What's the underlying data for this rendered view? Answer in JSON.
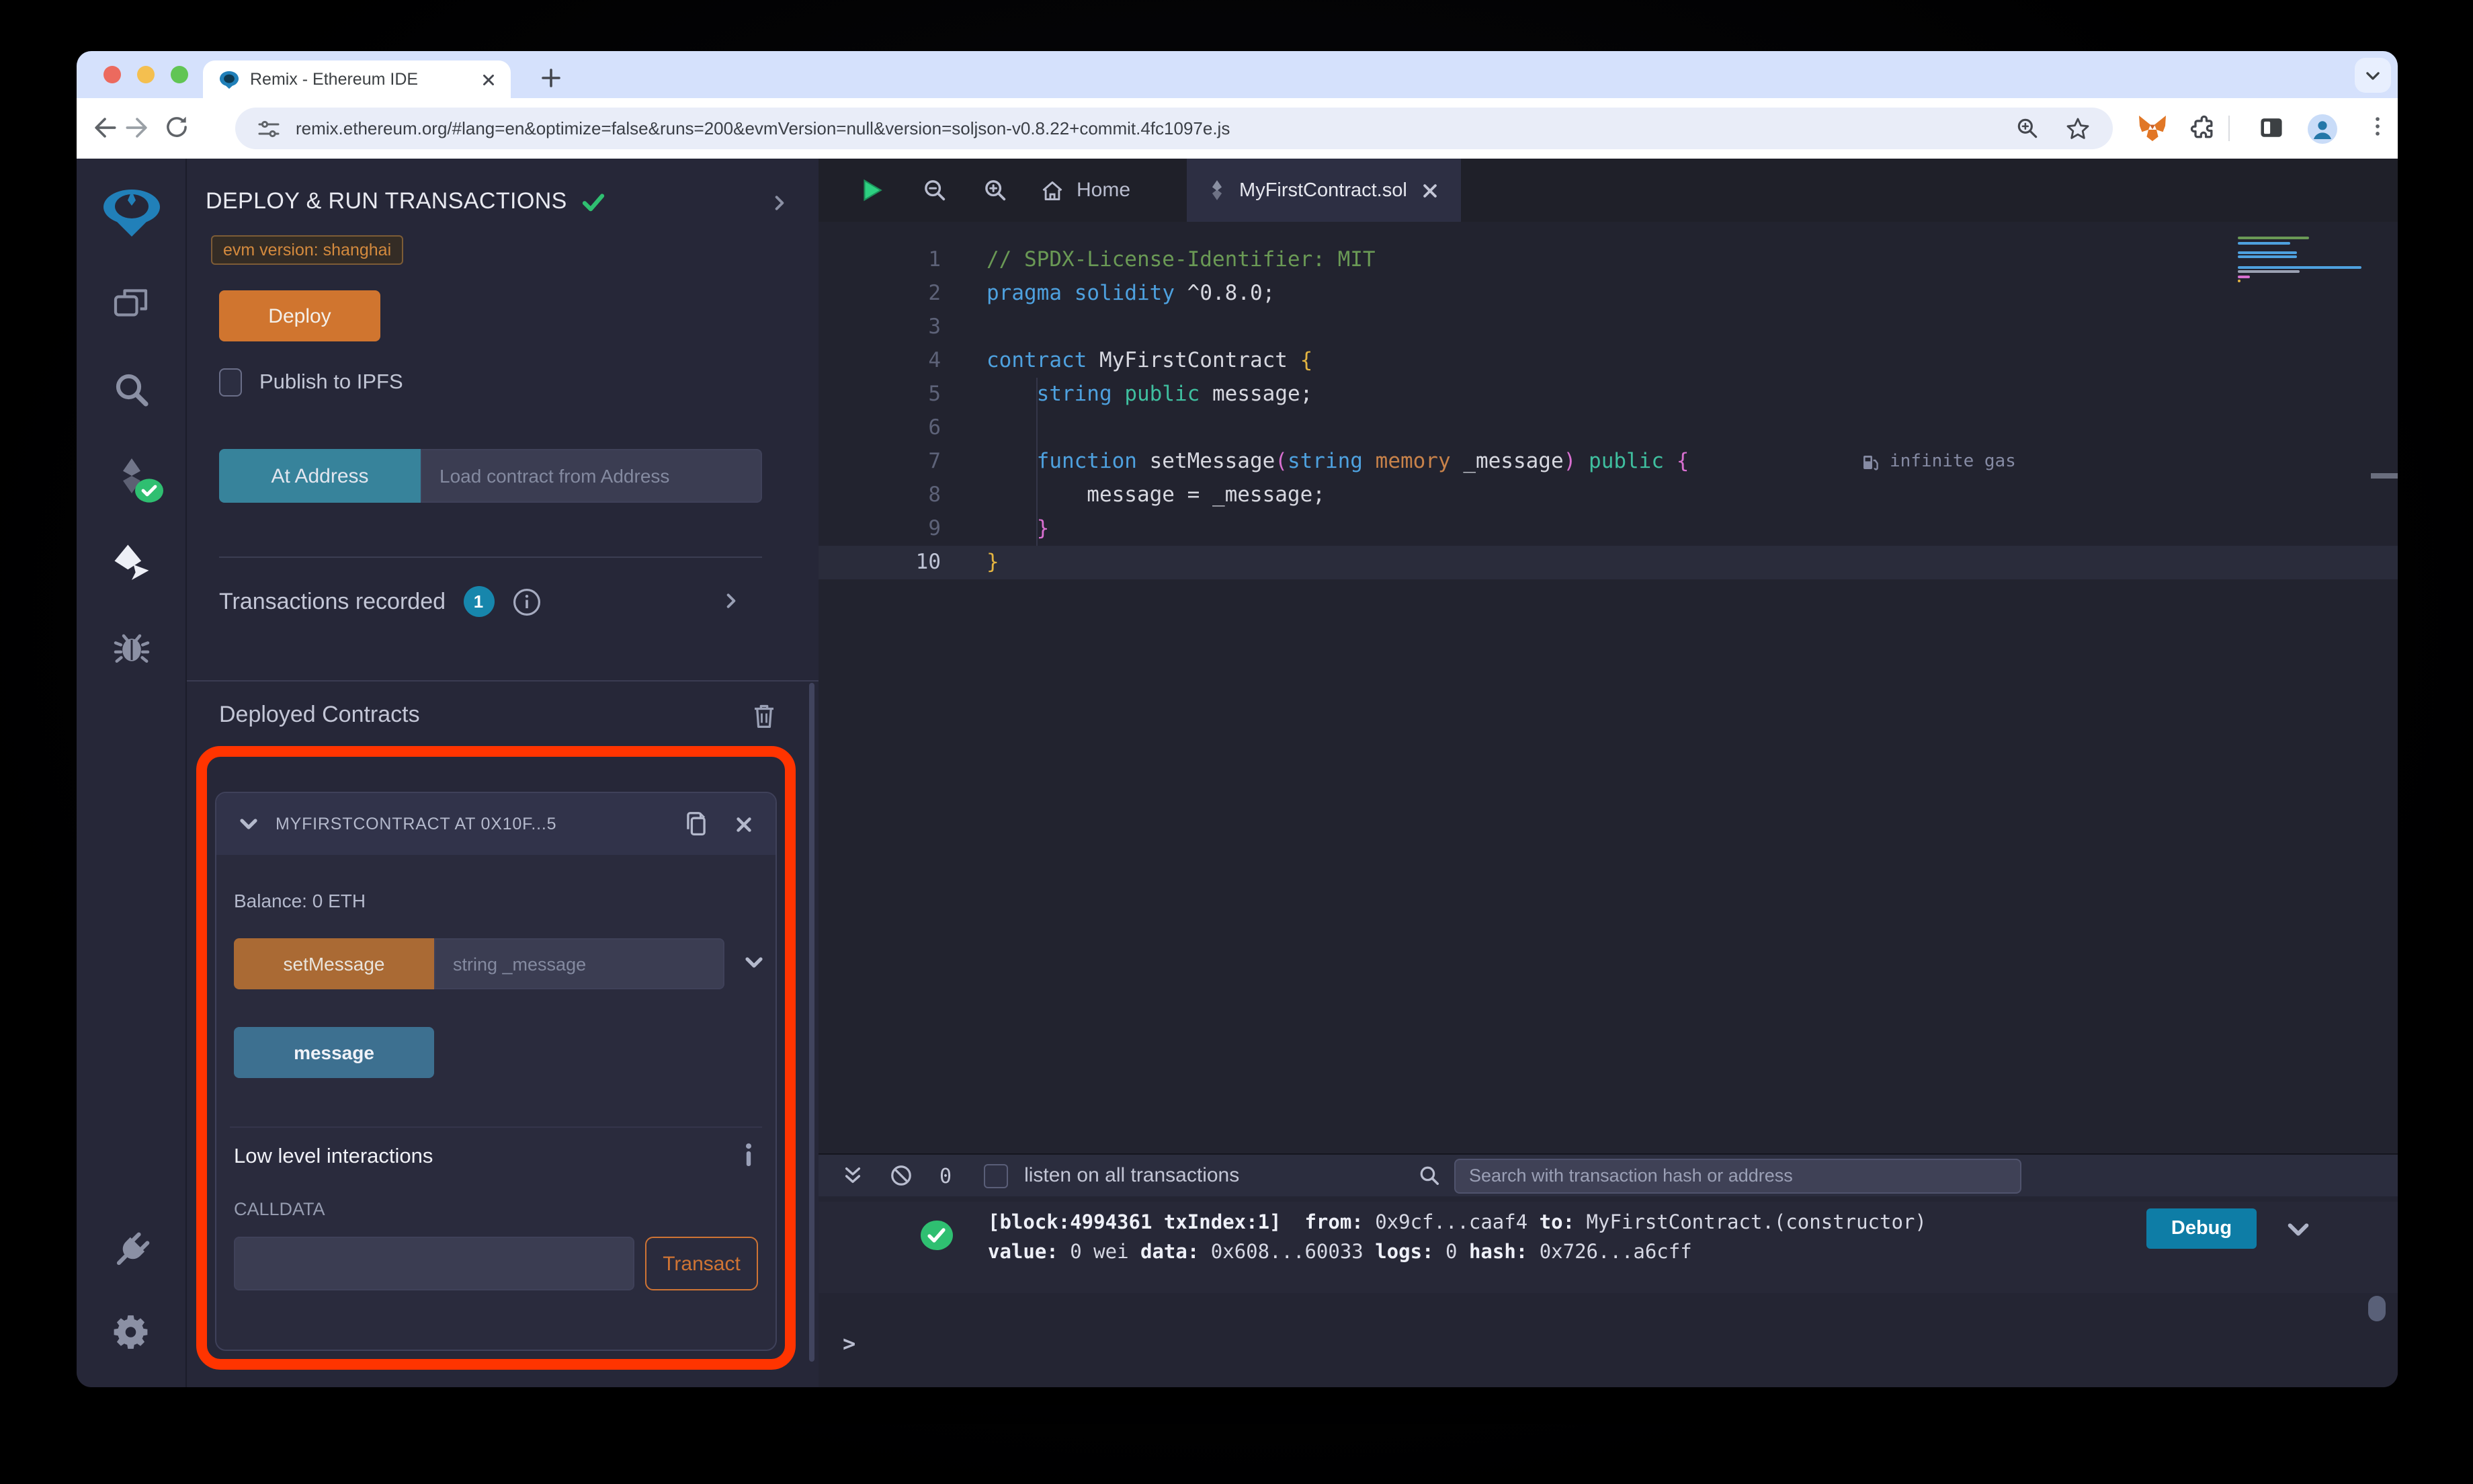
{
  "browser": {
    "tab_title": "Remix - Ethereum IDE",
    "url": "remix.ethereum.org/#lang=en&optimize=false&runs=200&evmVersion=null&version=soljson-v0.8.22+commit.4fc1097e.js"
  },
  "panel": {
    "title": "DEPLOY & RUN TRANSACTIONS",
    "evm_badge": "evm version: shanghai",
    "deploy_label": "Deploy",
    "publish_label": "Publish to IPFS",
    "at_address_label": "At Address",
    "at_address_placeholder": "Load contract from Address",
    "transactions_recorded_label": "Transactions recorded",
    "transactions_count": "1",
    "deployed_contracts_label": "Deployed Contracts",
    "contract": {
      "title": "MYFIRSTCONTRACT AT 0X10F...5",
      "balance": "Balance: 0 ETH",
      "set_message_label": "setMessage",
      "set_message_placeholder": "string _message",
      "message_label": "message",
      "low_level_label": "Low level interactions",
      "calldata_label": "CALLDATA",
      "transact_label": "Transact"
    }
  },
  "editor": {
    "tabs": {
      "home": "Home",
      "file": "MyFirstContract.sol"
    },
    "gas_label": "infinite gas",
    "code": {
      "colors": {
        "plain": "#d7d8e0",
        "comment": "#6a9955",
        "kw": "#4ea1df",
        "green": "#3fbf9f",
        "orange": "#c8824a",
        "b1": "#e2b341",
        "b2": "#d86fd0"
      },
      "lines": [
        {
          "s": [
            {
              "t": "// SPDX-License-Identifier: MIT",
              "c": "comment"
            }
          ]
        },
        {
          "s": [
            {
              "t": "pragma",
              "c": "kw"
            },
            {
              "t": " "
            },
            {
              "t": "solidity",
              "c": "kw"
            },
            {
              "t": " ^0.8.0;"
            }
          ]
        },
        {
          "s": []
        },
        {
          "s": [
            {
              "t": "contract",
              "c": "kw"
            },
            {
              "t": " MyFirstContract "
            },
            {
              "t": "{",
              "c": "b1"
            }
          ]
        },
        {
          "s": [
            {
              "t": "    "
            },
            {
              "t": "string",
              "c": "kw"
            },
            {
              "t": " "
            },
            {
              "t": "public",
              "c": "green"
            },
            {
              "t": " message;"
            }
          ]
        },
        {
          "s": []
        },
        {
          "s": [
            {
              "t": "    "
            },
            {
              "t": "function",
              "c": "kw"
            },
            {
              "t": " setMessage"
            },
            {
              "t": "(",
              "c": "b2"
            },
            {
              "t": "string",
              "c": "kw"
            },
            {
              "t": " "
            },
            {
              "t": "memory",
              "c": "orange"
            },
            {
              "t": " _message"
            },
            {
              "t": ")",
              "c": "b2"
            },
            {
              "t": " "
            },
            {
              "t": "public",
              "c": "green"
            },
            {
              "t": " "
            },
            {
              "t": "{",
              "c": "b2"
            }
          ],
          "gas": true
        },
        {
          "s": [
            {
              "t": "        message = _message;"
            }
          ]
        },
        {
          "s": [
            {
              "t": "    "
            },
            {
              "t": "}",
              "c": "b2"
            }
          ]
        },
        {
          "s": [
            {
              "t": "}",
              "c": "b1"
            }
          ],
          "current": true
        }
      ]
    }
  },
  "terminal": {
    "count": "0",
    "listen_label": "listen on all transactions",
    "search_placeholder": "Search with transaction hash or address",
    "debug_label": "Debug",
    "prompt": ">",
    "log": [
      [
        {
          "t": "[block:4994361 txIndex:1]",
          "b": 1
        },
        {
          "t": "  "
        },
        {
          "t": "from:",
          "b": 1
        },
        {
          "t": " 0x9cf...caaf4 "
        },
        {
          "t": "to:",
          "b": 1
        },
        {
          "t": " MyFirstContract.(constructor)"
        }
      ],
      [
        {
          "t": "value:",
          "b": 1
        },
        {
          "t": " 0 wei "
        },
        {
          "t": "data:",
          "b": 1
        },
        {
          "t": " 0x608...60033 "
        },
        {
          "t": "logs:",
          "b": 1
        },
        {
          "t": " 0 "
        },
        {
          "t": "hash:",
          "b": 1
        },
        {
          "t": " 0x726...a6cff"
        }
      ]
    ]
  },
  "colors": {
    "deploy_orange": "#d0752f",
    "accent_orange": "#cf7434",
    "at_address_teal": "#37839b",
    "message_steel_blue": "#3d7090",
    "set_message_orange": "#aa6a34",
    "debug_blue": "#0e7da6",
    "count_badge_blue": "#1786ac",
    "highlight_red": "#ff3400",
    "success_green": "#2fbf71",
    "evm_badge_orange": "#d48a3e"
  }
}
